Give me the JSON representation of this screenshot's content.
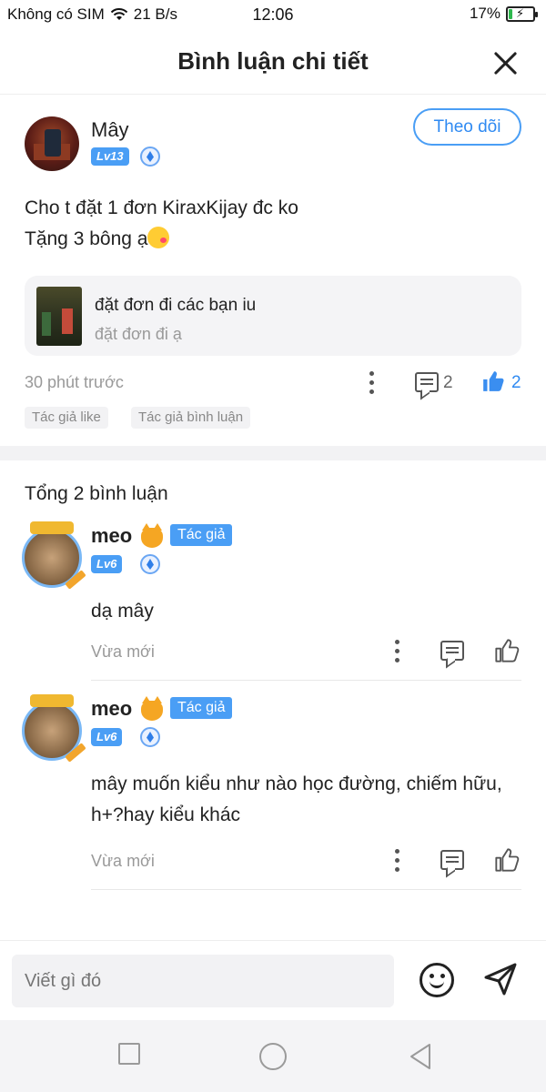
{
  "status_bar": {
    "carrier": "Không có SIM",
    "speed": "21 B/s",
    "time": "12:06",
    "battery": "17%",
    "battery_level": 0.17
  },
  "header": {
    "title": "Bình luận chi tiết"
  },
  "main_comment": {
    "username": "Mây",
    "level": "Lv13",
    "follow_label": "Theo dõi",
    "text_line1": "Cho t đặt 1 đơn KiraxKijay đc ko",
    "text_line2": "Tặng 3 bông ạ",
    "quote": {
      "title": "đặt đơn đi các bạn iu",
      "subtitle": "đặt đơn đi ạ"
    },
    "time": "30 phút trước",
    "reply_count": "2",
    "like_count": "2",
    "tags": [
      "Tác giả like",
      "Tác giả bình luận"
    ]
  },
  "comments": {
    "total": "Tổng 2 bình luận",
    "items": [
      {
        "username": "meo",
        "author_tag": "Tác giả",
        "level": "Lv6",
        "text": "dạ mây",
        "time": "Vừa mới"
      },
      {
        "username": "meo",
        "author_tag": "Tác giả",
        "level": "Lv6",
        "text": "mây muốn kiểu như nào học đường, chiếm hữu, h+?hay kiểu khác",
        "time": "Vừa mới"
      }
    ]
  },
  "input": {
    "placeholder": "Viết gì đó"
  },
  "colors": {
    "accent": "#4a9ef5",
    "text": "#222222",
    "muted": "#999999"
  }
}
